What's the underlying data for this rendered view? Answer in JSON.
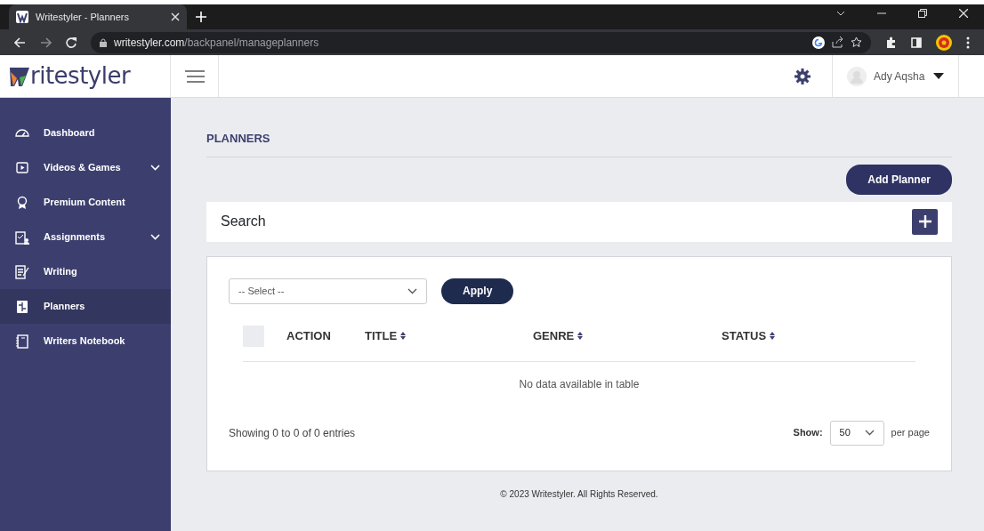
{
  "browser": {
    "tab_title": "Writestyler - Planners",
    "url_host": "writestyler.com",
    "url_path": "/backpanel/manageplanners"
  },
  "header": {
    "logo_text": "ritestyler",
    "user_name": "Ady Aqsha"
  },
  "sidebar": {
    "items": [
      {
        "label": "Dashboard",
        "kind": "gauge",
        "expandable": false,
        "selected": false
      },
      {
        "label": "Videos & Games",
        "kind": "video",
        "expandable": true,
        "selected": false
      },
      {
        "label": "Premium Content",
        "kind": "award",
        "expandable": false,
        "selected": false
      },
      {
        "label": "Assignments",
        "kind": "clipboard",
        "expandable": true,
        "selected": false
      },
      {
        "label": "Writing",
        "kind": "writing",
        "expandable": false,
        "selected": false
      },
      {
        "label": "Planners",
        "kind": "planner",
        "expandable": false,
        "selected": true
      },
      {
        "label": "Writers Notebook",
        "kind": "notebook",
        "expandable": false,
        "selected": false
      }
    ]
  },
  "page": {
    "title": "PLANNERS",
    "add_button": "Add Planner",
    "search_title": "Search"
  },
  "filter": {
    "placeholder": "-- Select --",
    "apply": "Apply"
  },
  "table": {
    "select_all_checked": false,
    "columns": [
      {
        "label": "ACTION",
        "sortable": false
      },
      {
        "label": "TITLE",
        "sortable": true
      },
      {
        "label": "GENRE",
        "sortable": true
      },
      {
        "label": "STATUS",
        "sortable": true
      }
    ],
    "empty_text": "No data available in table",
    "info": "Showing 0 to 0 of 0 entries",
    "show_label": "Show:",
    "page_size": "50",
    "per_page": "per page"
  },
  "footer": "© 2023 Writestyler. All Rights Reserved."
}
